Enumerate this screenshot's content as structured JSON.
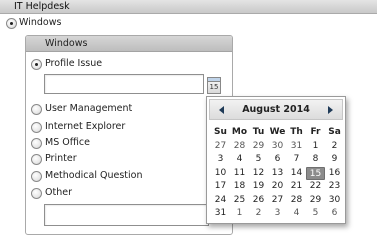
{
  "app": {
    "title": "IT Helpdesk"
  },
  "top_option": {
    "label": "Windows",
    "selected": true
  },
  "panel": {
    "header": "Windows",
    "options": [
      {
        "label": "Profile Issue",
        "selected": true
      },
      {
        "label": "User Management",
        "selected": false
      },
      {
        "label": "Internet Explorer",
        "selected": false
      },
      {
        "label": "MS Office",
        "selected": false
      },
      {
        "label": "Printer",
        "selected": false
      },
      {
        "label": "Methodical Question",
        "selected": false
      },
      {
        "label": "Other",
        "selected": false
      }
    ],
    "profile_issue_input_value": "",
    "other_input_value": ""
  },
  "calendar_button": {
    "icon": "calendar-icon",
    "day_label": "15"
  },
  "datepicker": {
    "month_label": "August 2014",
    "prev_icon": "chevron-left-icon",
    "next_icon": "chevron-right-icon",
    "weekdays": [
      "Su",
      "Mo",
      "Tu",
      "We",
      "Th",
      "Fr",
      "Sa"
    ],
    "weeks": [
      [
        "27",
        "28",
        "29",
        "30",
        "31",
        "1",
        "2"
      ],
      [
        "3",
        "4",
        "5",
        "6",
        "7",
        "8",
        "9"
      ],
      [
        "10",
        "11",
        "12",
        "13",
        "14",
        "15",
        "16"
      ],
      [
        "17",
        "18",
        "19",
        "20",
        "21",
        "22",
        "23"
      ],
      [
        "24",
        "25",
        "26",
        "27",
        "28",
        "29",
        "30"
      ],
      [
        "31",
        "1",
        "2",
        "3",
        "4",
        "5",
        "6"
      ]
    ],
    "selected_day": "15",
    "selected_color": "#8c8c8c"
  }
}
